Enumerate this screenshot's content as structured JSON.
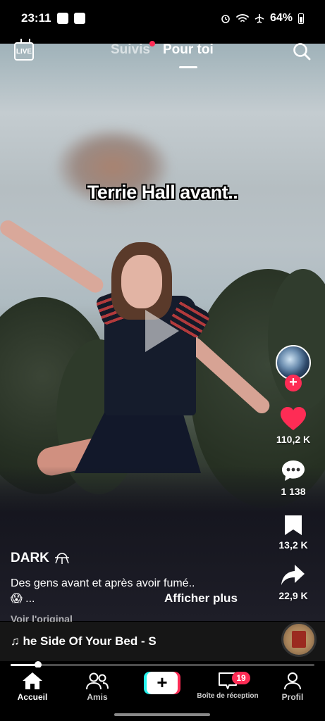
{
  "status_bar": {
    "time": "23:11",
    "battery": "64%"
  },
  "top_nav": {
    "live_label": "LIVE",
    "tabs": [
      {
        "label": "Suivis",
        "active": false,
        "has_dot": true
      },
      {
        "label": "Pour toi",
        "active": true
      }
    ]
  },
  "video": {
    "overlay_caption": "Terrie Hall avant.."
  },
  "actions": {
    "likes": "110,2 K",
    "comments": "1 138",
    "saves": "13,2 K",
    "shares": "22,9 K",
    "follow_symbol": "+"
  },
  "post": {
    "author": "DARK",
    "description_line1": "Des gens avant et après avoir fumé..",
    "description_line2": "😱 ...",
    "more_label": "Afficher plus",
    "view_original": "Voir l'original",
    "sound": "♫ he Side Of Your Bed - S",
    "progress_fraction": 0.09
  },
  "bottom_nav": {
    "items": [
      {
        "label": "Accueil",
        "active": true
      },
      {
        "label": "Amis",
        "active": false
      },
      {
        "label": "+",
        "active": false
      },
      {
        "label": "Boîte de réception",
        "active": false,
        "badge": "19"
      },
      {
        "label": "Profil",
        "active": false
      }
    ]
  },
  "colors": {
    "accent": "#fe2c55",
    "cyan": "#25f4ee",
    "background": "#000000"
  }
}
